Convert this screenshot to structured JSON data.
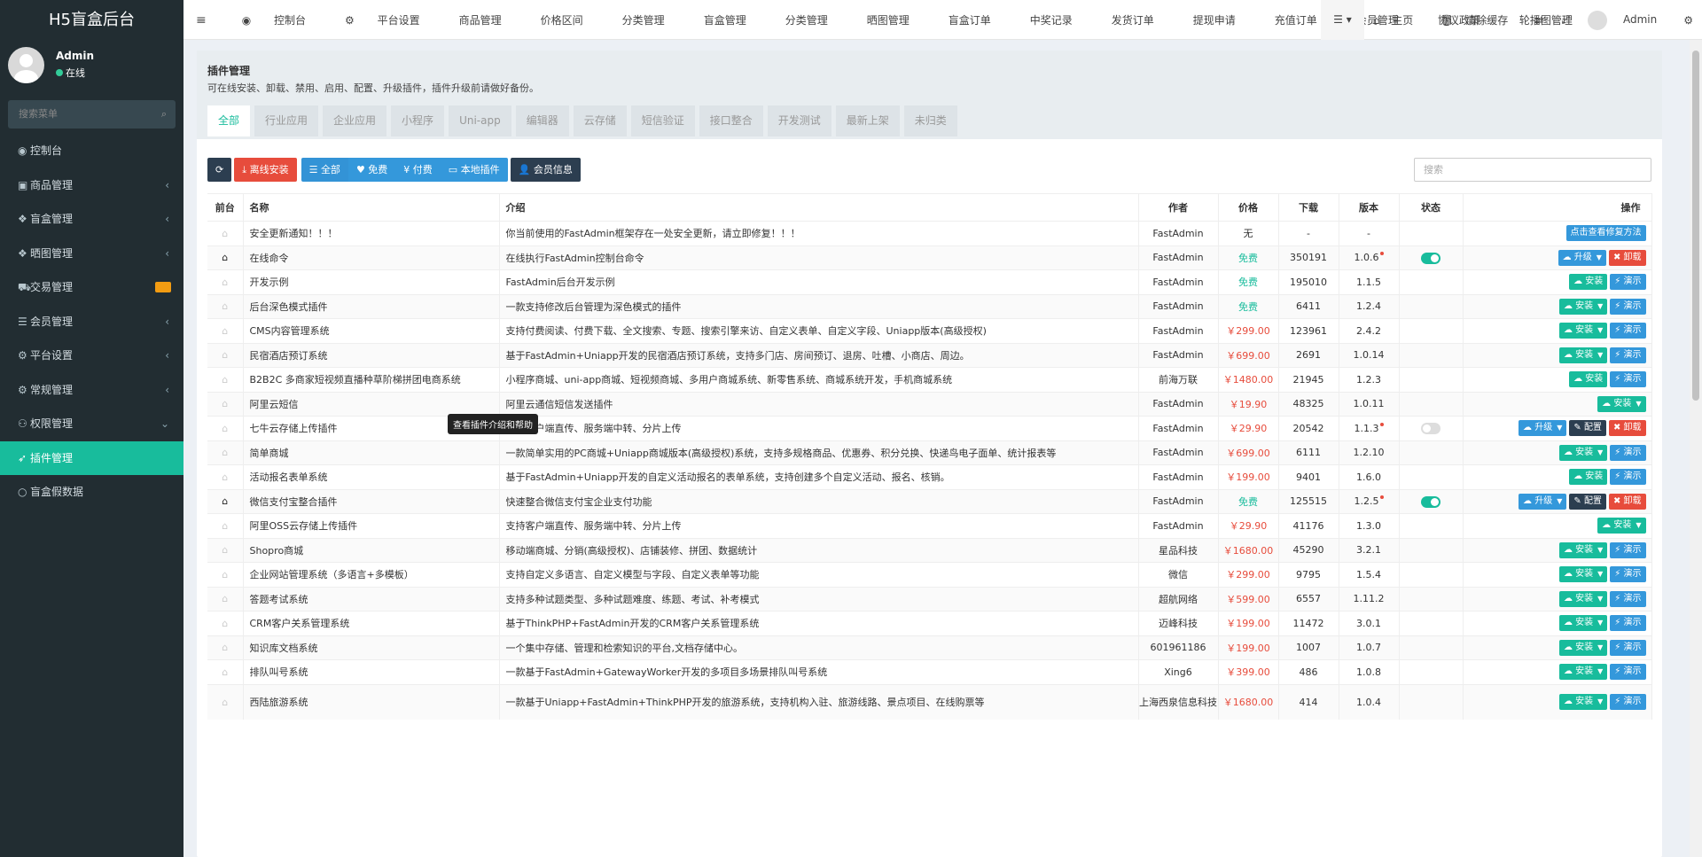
{
  "app_title": "H5盲盒后台",
  "user": {
    "name": "Admin",
    "status": "在线"
  },
  "sidebar": {
    "search_placeholder": "搜索菜单",
    "items": [
      {
        "label": "控制台",
        "icon": "dashboard-icon",
        "arrow": ""
      },
      {
        "label": "商品管理",
        "icon": "shopping-bag-icon",
        "arrow": "‹"
      },
      {
        "label": "盲盒管理",
        "icon": "box-icon",
        "arrow": "‹"
      },
      {
        "label": "晒图管理",
        "icon": "image-icon",
        "arrow": "‹"
      },
      {
        "label": "交易管理",
        "icon": "cart-icon",
        "arrow": ""
      },
      {
        "label": "会员管理",
        "icon": "list-icon",
        "arrow": "‹"
      },
      {
        "label": "平台设置",
        "icon": "cogs-icon",
        "arrow": "‹"
      },
      {
        "label": "常规管理",
        "icon": "cogs-icon",
        "arrow": "‹"
      },
      {
        "label": "权限管理",
        "icon": "group-icon",
        "arrow": "⌄"
      },
      {
        "label": "插件管理",
        "icon": "rocket-icon",
        "arrow": ""
      },
      {
        "label": "盲盒假数据",
        "icon": "circle-icon",
        "arrow": ""
      }
    ]
  },
  "topnav": [
    "控制台",
    "平台设置",
    "商品管理",
    "价格区间",
    "分类管理",
    "盲盒管理",
    "分类管理",
    "晒图管理",
    "盲盒订单",
    "中奖记录",
    "发货订单",
    "提现申请",
    "充值订单",
    "会员管理",
    "协议政策",
    "轮播图管理"
  ],
  "topright": {
    "home": "主页",
    "clear": "清除缓存",
    "admin": "Admin"
  },
  "page": {
    "title": "插件管理",
    "desc": "可在线安装、卸载、禁用、启用、配置、升级插件，插件升级前请做好备份。"
  },
  "tabs": [
    "全部",
    "行业应用",
    "企业应用",
    "小程序",
    "Uni-app",
    "编辑器",
    "云存储",
    "短信验证",
    "接口整合",
    "开发测试",
    "最新上架",
    "未归类"
  ],
  "toolbar": {
    "offline": "离线安装",
    "all": "全部",
    "free": "免费",
    "paid": "付费",
    "local": "本地插件",
    "member": "会员信息",
    "search_placeholder": "搜索"
  },
  "table": {
    "headers": [
      "前台",
      "名称",
      "介绍",
      "作者",
      "价格",
      "下载",
      "版本",
      "状态",
      "操作"
    ],
    "rows": [
      {
        "home": false,
        "name": "安全更新通知！！！",
        "intro": "你当前使用的FastAdmin框架存在一处安全更新，请立即修复！！！",
        "author": "FastAdmin",
        "price": "无",
        "ptype": "none",
        "dl": "-",
        "ver": "-",
        "newv": false,
        "status": "",
        "ops": "fix"
      },
      {
        "home": true,
        "name": "在线命令",
        "intro": "在线执行FastAdmin控制台命令",
        "author": "FastAdmin",
        "price": "免费",
        "ptype": "free",
        "dl": "350191",
        "ver": "1.0.6",
        "newv": true,
        "status": "on",
        "ops": "upgrade-uninstall"
      },
      {
        "home": false,
        "name": "开发示例",
        "intro": "FastAdmin后台开发示例",
        "author": "FastAdmin",
        "price": "免费",
        "ptype": "free",
        "dl": "195010",
        "ver": "1.1.5",
        "newv": false,
        "status": "",
        "ops": "install-demo"
      },
      {
        "home": false,
        "name": "后台深色模式插件",
        "intro": "一款支持修改后台管理为深色模式的插件",
        "author": "FastAdmin",
        "price": "免费",
        "ptype": "free",
        "dl": "6411",
        "ver": "1.2.4",
        "newv": false,
        "status": "",
        "ops": "install-drop-demo"
      },
      {
        "home": false,
        "name": "CMS内容管理系统",
        "intro": "支持付费阅读、付费下载、全文搜索、专题、搜索引擎来访、自定义表单、自定义字段、Uniapp版本(高级授权)",
        "author": "FastAdmin",
        "price": "￥299.00",
        "ptype": "paid",
        "dl": "123961",
        "ver": "2.4.2",
        "newv": false,
        "status": "",
        "ops": "install-drop-demo"
      },
      {
        "home": false,
        "name": "民宿酒店预订系统",
        "intro": "基于FastAdmin+Uniapp开发的民宿酒店预订系统，支持多门店、房间预订、退房、吐槽、小商店、周边。",
        "author": "FastAdmin",
        "price": "￥699.00",
        "ptype": "paid",
        "dl": "2691",
        "ver": "1.0.14",
        "newv": false,
        "status": "",
        "ops": "install-drop-demo"
      },
      {
        "home": false,
        "name": "B2B2C 多商家短视频直播种草阶梯拼团电商系统",
        "intro": "小程序商城、uni-app商城、短视频商城、多用户商城系统、新零售系统、商城系统开发，手机商城系统",
        "author": "前海万联",
        "price": "￥1480.00",
        "ptype": "paid",
        "dl": "21945",
        "ver": "1.2.3",
        "newv": false,
        "status": "",
        "ops": "install-demo"
      },
      {
        "home": false,
        "name": "阿里云短信",
        "intro": "阿里云通信短信发送插件",
        "author": "FastAdmin",
        "price": "￥19.90",
        "ptype": "paid",
        "dl": "48325",
        "ver": "1.0.11",
        "newv": false,
        "status": "",
        "ops": "install-drop"
      },
      {
        "home": false,
        "name": "七牛云存储上传插件",
        "intro": "支持客户端直传、服务端中转、分片上传",
        "author": "FastAdmin",
        "price": "￥29.90",
        "ptype": "paid",
        "dl": "20542",
        "ver": "1.1.3",
        "newv": true,
        "status": "off",
        "ops": "upgrade-config-uninstall"
      },
      {
        "home": false,
        "name": "简单商城",
        "intro": "一款简单实用的PC商城+Uniapp商城版本(高级授权)系统，支持多规格商品、优惠券、积分兑换、快递鸟电子面单、统计报表等",
        "author": "FastAdmin",
        "price": "￥699.00",
        "ptype": "paid",
        "dl": "6111",
        "ver": "1.2.10",
        "newv": false,
        "status": "",
        "ops": "install-drop-demo"
      },
      {
        "home": false,
        "name": "活动报名表单系统",
        "intro": "基于FastAdmin+Uniapp开发的自定义活动报名的表单系统，支持创建多个自定义活动、报名、核销。",
        "author": "FastAdmin",
        "price": "￥199.00",
        "ptype": "paid",
        "dl": "9401",
        "ver": "1.6.0",
        "newv": false,
        "status": "",
        "ops": "install-demo"
      },
      {
        "home": true,
        "name": "微信支付宝整合插件",
        "intro": "快速整合微信支付宝企业支付功能",
        "author": "FastAdmin",
        "price": "免费",
        "ptype": "free",
        "dl": "125515",
        "ver": "1.2.5",
        "newv": true,
        "status": "on",
        "ops": "upgrade-config-uninstall"
      },
      {
        "home": false,
        "name": "阿里OSS云存储上传插件",
        "intro": "支持客户端直传、服务端中转、分片上传",
        "author": "FastAdmin",
        "price": "￥29.90",
        "ptype": "paid",
        "dl": "41176",
        "ver": "1.3.0",
        "newv": false,
        "status": "",
        "ops": "install-drop"
      },
      {
        "home": false,
        "name": "Shopro商城",
        "intro": "移动端商城、分销(高级授权)、店铺装修、拼团、数据统计",
        "author": "星品科技",
        "price": "￥1680.00",
        "ptype": "paid",
        "dl": "45290",
        "ver": "3.2.1",
        "newv": false,
        "status": "",
        "ops": "install-drop-demo"
      },
      {
        "home": false,
        "name": "企业网站管理系统（多语言+多模板）",
        "intro": "支持自定义多语言、自定义模型与字段、自定义表单等功能",
        "author": "微信",
        "price": "￥299.00",
        "ptype": "paid",
        "dl": "9795",
        "ver": "1.5.4",
        "newv": false,
        "status": "",
        "ops": "install-drop-demo"
      },
      {
        "home": false,
        "name": "答题考试系统",
        "intro": "支持多种试题类型、多种试题难度、练题、考试、补考模式",
        "author": "超航网络",
        "price": "￥599.00",
        "ptype": "paid",
        "dl": "6557",
        "ver": "1.11.2",
        "newv": false,
        "status": "",
        "ops": "install-drop-demo"
      },
      {
        "home": false,
        "name": "CRM客户关系管理系统",
        "intro": "基于ThinkPHP+FastAdmin开发的CRM客户关系管理系统",
        "author": "迈峰科技",
        "price": "￥199.00",
        "ptype": "paid",
        "dl": "11472",
        "ver": "3.0.1",
        "newv": false,
        "status": "",
        "ops": "install-drop-demo"
      },
      {
        "home": false,
        "name": "知识库文档系统",
        "intro": "一个集中存储、管理和检索知识的平台,文档存储中心。",
        "author": "601961186",
        "price": "￥199.00",
        "ptype": "paid",
        "dl": "1007",
        "ver": "1.0.7",
        "newv": false,
        "status": "",
        "ops": "install-drop-demo"
      },
      {
        "home": false,
        "name": "排队叫号系统",
        "intro": "一款基于FastAdmin+GatewayWorker开发的多项目多场景排队叫号系统",
        "author": "Xing6",
        "price": "￥399.00",
        "ptype": "paid",
        "dl": "486",
        "ver": "1.0.8",
        "newv": false,
        "status": "",
        "ops": "install-drop-demo"
      },
      {
        "home": false,
        "name": "西陆旅游系统",
        "intro": "一款基于Uniapp+FastAdmin+ThinkPHP开发的旅游系统，支持机构入驻、旅游线路、景点项目、在线购票等",
        "author": "上海西泉信息科技",
        "price": "￥1680.00",
        "ptype": "paid",
        "dl": "414",
        "ver": "1.0.4",
        "newv": false,
        "status": "",
        "ops": "install-drop-demo"
      }
    ]
  },
  "ops_labels": {
    "fix": "点击查看修复方法",
    "upgrade": "升级",
    "uninstall": "卸载",
    "install": "安装",
    "demo": "演示",
    "config": "配置"
  },
  "tooltip": "查看插件介绍和帮助",
  "colors": {
    "accent": "#18bc9c",
    "danger": "#e74c3c",
    "primary": "#3498db",
    "dark": "#2c3e50",
    "sidebar": "#222d32"
  }
}
